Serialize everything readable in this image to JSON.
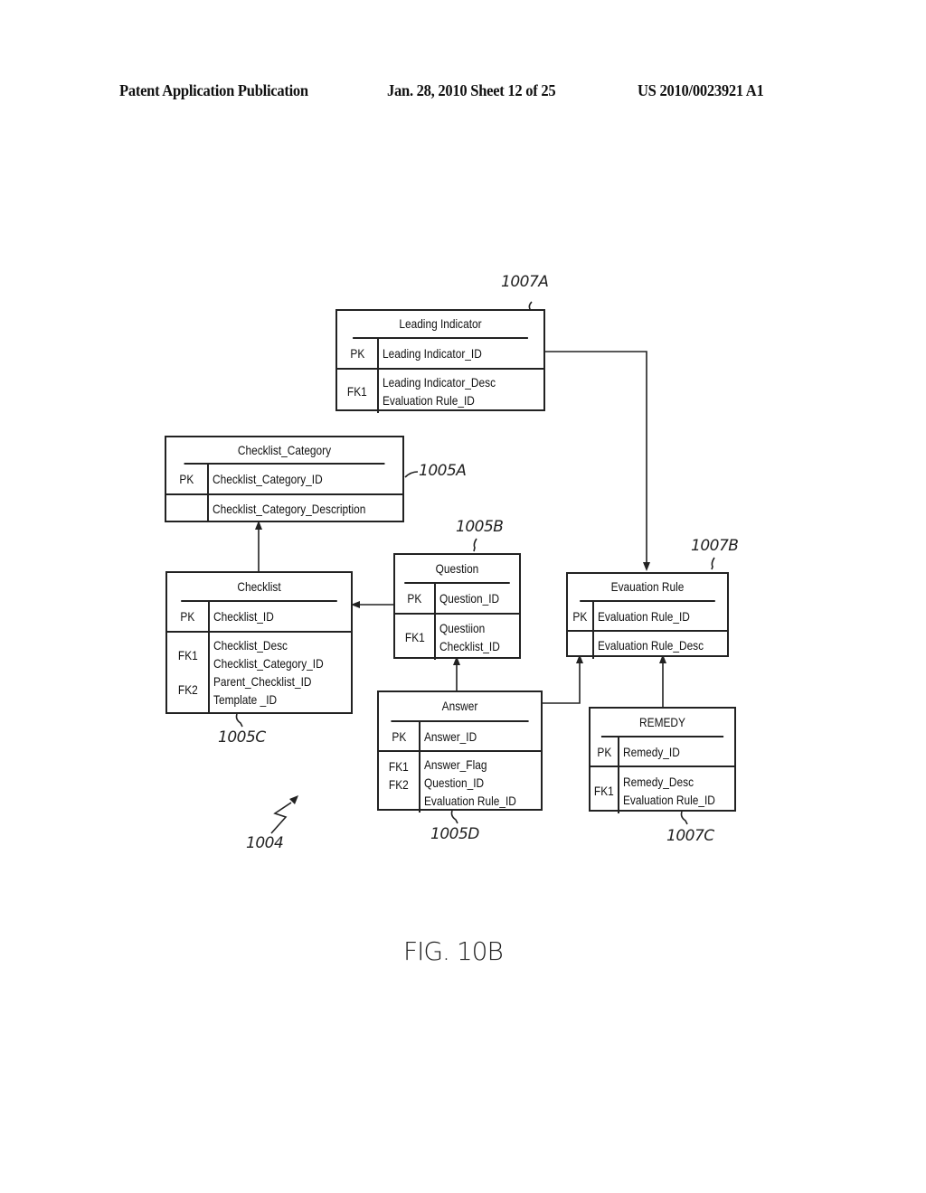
{
  "header": {
    "publication": "Patent Application Publication",
    "date_sheet": "Jan. 28, 2010  Sheet 12 of 25",
    "number": "US 2010/0023921 A1"
  },
  "figure": {
    "label": "FIG. 10B",
    "reference": "1004"
  },
  "entities": {
    "leading_indicator": {
      "ref": "1007A",
      "title": "Leading Indicator",
      "pk_label": "PK",
      "pk_fields": [
        "Leading Indicator_ID"
      ],
      "fk_labels": [
        "FK1"
      ],
      "fields": [
        "Leading Indicator_Desc",
        "Evaluation Rule_ID"
      ]
    },
    "checklist_category": {
      "ref": "1005A",
      "title": "Checklist_Category",
      "pk_label": "PK",
      "pk_fields": [
        "Checklist_Category_ID"
      ],
      "fk_labels": [],
      "fields": [
        "Checklist_Category_Description"
      ]
    },
    "question": {
      "ref": "1005B",
      "title": "Question",
      "pk_label": "PK",
      "pk_fields": [
        "Question_ID"
      ],
      "fk_labels": [
        "FK1"
      ],
      "fields": [
        "Questiion",
        "Checklist_ID"
      ]
    },
    "evaluation_rule": {
      "ref": "1007B",
      "title": "Evauation Rule",
      "pk_label": "PK",
      "pk_fields": [
        "Evaluation Rule_ID"
      ],
      "fk_labels": [],
      "fields": [
        "Evaluation Rule_Desc"
      ]
    },
    "checklist": {
      "ref": "1005C",
      "title": "Checklist",
      "pk_label": "PK",
      "pk_fields": [
        "Checklist_ID"
      ],
      "fk_labels": [
        "FK1",
        "FK2"
      ],
      "fields": [
        "Checklist_Desc",
        "Checklist_Category_ID",
        "Parent_Checklist_ID",
        "Template _ID"
      ]
    },
    "answer": {
      "ref": "1005D",
      "title": "Answer",
      "pk_label": "PK",
      "pk_fields": [
        "Answer_ID"
      ],
      "fk_labels": [
        "FK1",
        "FK2"
      ],
      "fields": [
        "Answer_Flag",
        "Question_ID",
        "Evaluation Rule_ID"
      ]
    },
    "remedy": {
      "ref": "1007C",
      "title": "REMEDY",
      "pk_label": "PK",
      "pk_fields": [
        "Remedy_ID"
      ],
      "fk_labels": [
        "FK1"
      ],
      "fields": [
        "Remedy_Desc",
        "Evaluation Rule_ID"
      ]
    }
  },
  "relationships": [
    {
      "from": "leading_indicator",
      "to": "evaluation_rule"
    },
    {
      "from": "checklist",
      "to": "checklist_category"
    },
    {
      "from": "question",
      "to": "checklist"
    },
    {
      "from": "answer",
      "to": "question"
    },
    {
      "from": "answer",
      "to": "evaluation_rule"
    },
    {
      "from": "remedy",
      "to": "evaluation_rule"
    }
  ]
}
